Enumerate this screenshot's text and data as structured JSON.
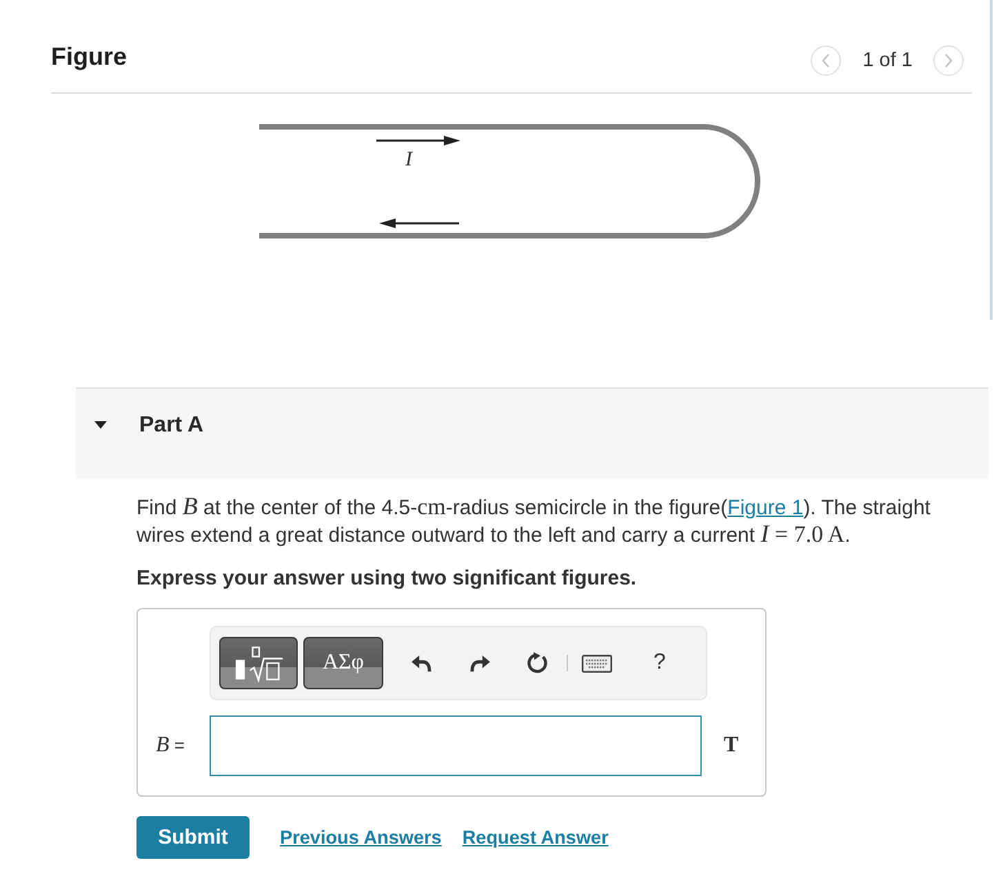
{
  "figure_panel": {
    "title": "Figure",
    "pager": {
      "prev": {
        "disabled": true
      },
      "counter": "1 of 1",
      "next": {
        "disabled": true
      }
    },
    "current_label": "I"
  },
  "part": {
    "title": "Part A",
    "expanded": true
  },
  "question": {
    "parts": [
      {
        "kind": "text",
        "text": "Find "
      },
      {
        "kind": "var",
        "text": "B"
      },
      {
        "kind": "text",
        "text": " at the center of the 4.5-"
      },
      {
        "kind": "unit",
        "text": "cm"
      },
      {
        "kind": "text",
        "text": "-radius semicircle in the figure("
      },
      {
        "kind": "link",
        "text": "Figure 1"
      },
      {
        "kind": "text",
        "text": "). The straight wires extend a great distance outward to the left and carry a current "
      },
      {
        "kind": "var",
        "text": "I"
      },
      {
        "kind": "unit",
        "text": " = 7.0 A"
      },
      {
        "kind": "text",
        "text": "."
      }
    ],
    "instruction": "Express your answer using two significant figures."
  },
  "answer": {
    "toolbar": [
      {
        "kind": "templates"
      },
      {
        "kind": "symbols",
        "label": "ΑΣφ"
      },
      {
        "kind": "undo"
      },
      {
        "kind": "redo"
      },
      {
        "kind": "reset"
      },
      {
        "kind": "keyboard"
      },
      {
        "kind": "help",
        "label": "?"
      }
    ],
    "label": {
      "variable": "B",
      "sign": "="
    },
    "unit": "T"
  },
  "actions": {
    "submit": "Submit",
    "links": [
      "Previous Answers",
      "Request Answer"
    ]
  }
}
